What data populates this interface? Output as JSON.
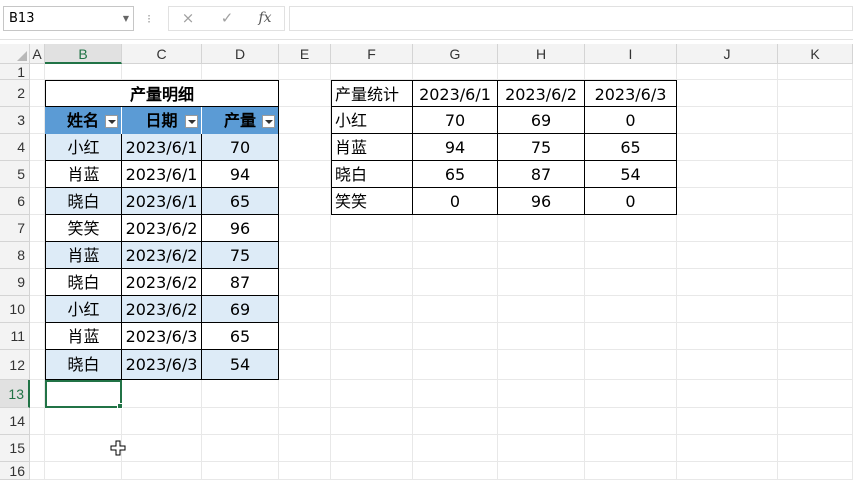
{
  "formula_bar": {
    "name_box": "B13",
    "separator": "⁝",
    "cancel_icon": "×",
    "enter_icon": "✓",
    "fx_label": "fx",
    "formula": ""
  },
  "grid": {
    "columns": [
      "A",
      "B",
      "C",
      "D",
      "E",
      "F",
      "G",
      "H",
      "I",
      "J",
      "K"
    ],
    "rows": [
      "1",
      "2",
      "3",
      "4",
      "5",
      "6",
      "7",
      "8",
      "9",
      "10",
      "11",
      "12",
      "13",
      "14",
      "15",
      "16"
    ],
    "selected_column": "B",
    "selected_row": "13"
  },
  "detail_table": {
    "title": "产量明细",
    "headers": [
      "姓名",
      "日期",
      "产量"
    ],
    "rows": [
      [
        "小红",
        "2023/6/1",
        "70"
      ],
      [
        "肖蓝",
        "2023/6/1",
        "94"
      ],
      [
        "晓白",
        "2023/6/1",
        "65"
      ],
      [
        "笑笑",
        "2023/6/2",
        "96"
      ],
      [
        "肖蓝",
        "2023/6/2",
        "75"
      ],
      [
        "晓白",
        "2023/6/2",
        "87"
      ],
      [
        "小红",
        "2023/6/2",
        "69"
      ],
      [
        "肖蓝",
        "2023/6/3",
        "65"
      ],
      [
        "晓白",
        "2023/6/3",
        "54"
      ]
    ]
  },
  "summary_table": {
    "headers": [
      "产量统计",
      "2023/6/1",
      "2023/6/2",
      "2023/6/3"
    ],
    "rows": [
      [
        "小红",
        "70",
        "69",
        "0"
      ],
      [
        "肖蓝",
        "94",
        "75",
        "65"
      ],
      [
        "晓白",
        "65",
        "87",
        "54"
      ],
      [
        "笑笑",
        "0",
        "96",
        "0"
      ]
    ]
  },
  "colors": {
    "accent": "#217346",
    "table_header": "#5b9bd5",
    "table_band": "#ddebf7"
  }
}
